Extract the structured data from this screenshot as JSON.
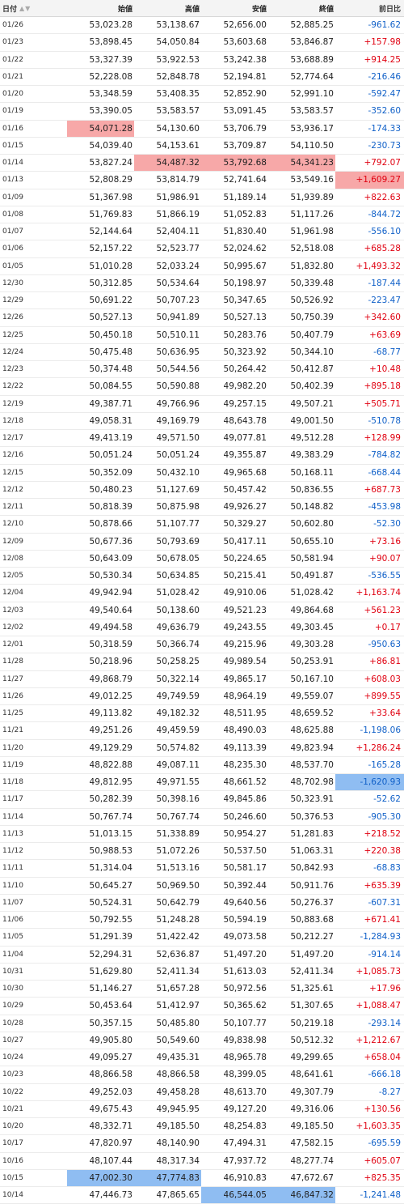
{
  "header": {
    "date": "日付",
    "sort_icon": "▲▼",
    "open": "始値",
    "high": "高値",
    "low": "安値",
    "close": "終値",
    "change": "前日比"
  },
  "colors": {
    "up": "#e00010",
    "down": "#1060c8",
    "highlight_high": "#f7a8a8",
    "highlight_low": "#8fbdf2"
  },
  "rows": [
    {
      "date": "01/26",
      "open": "53,023.28",
      "high": "53,138.67",
      "low": "52,656.00",
      "close": "52,885.25",
      "change": "-961.62",
      "dir": "neg",
      "hl": {}
    },
    {
      "date": "01/23",
      "open": "53,898.45",
      "high": "54,050.84",
      "low": "53,603.68",
      "close": "53,846.87",
      "change": "+157.98",
      "dir": "pos",
      "hl": {}
    },
    {
      "date": "01/22",
      "open": "53,327.39",
      "high": "53,922.53",
      "low": "53,242.38",
      "close": "53,688.89",
      "change": "+914.25",
      "dir": "pos",
      "hl": {}
    },
    {
      "date": "01/21",
      "open": "52,228.08",
      "high": "52,848.78",
      "low": "52,194.81",
      "close": "52,774.64",
      "change": "-216.46",
      "dir": "neg",
      "hl": {}
    },
    {
      "date": "01/20",
      "open": "53,348.59",
      "high": "53,408.35",
      "low": "52,852.90",
      "close": "52,991.10",
      "change": "-592.47",
      "dir": "neg",
      "hl": {}
    },
    {
      "date": "01/19",
      "open": "53,390.05",
      "high": "53,583.57",
      "low": "53,091.45",
      "close": "53,583.57",
      "change": "-352.60",
      "dir": "neg",
      "hl": {}
    },
    {
      "date": "01/16",
      "open": "54,071.28",
      "high": "54,130.60",
      "low": "53,706.79",
      "close": "53,936.17",
      "change": "-174.33",
      "dir": "neg",
      "hl": {
        "open": "red"
      }
    },
    {
      "date": "01/15",
      "open": "54,039.40",
      "high": "54,153.61",
      "low": "53,709.87",
      "close": "54,110.50",
      "change": "-230.73",
      "dir": "neg",
      "hl": {}
    },
    {
      "date": "01/14",
      "open": "53,827.24",
      "high": "54,487.32",
      "low": "53,792.68",
      "close": "54,341.23",
      "change": "+792.07",
      "dir": "pos",
      "hl": {
        "high": "red",
        "low": "red",
        "close": "red"
      }
    },
    {
      "date": "01/13",
      "open": "52,808.29",
      "high": "53,814.79",
      "low": "52,741.64",
      "close": "53,549.16",
      "change": "+1,609.27",
      "dir": "pos",
      "hl": {
        "change": "red"
      }
    },
    {
      "date": "01/09",
      "open": "51,367.98",
      "high": "51,986.91",
      "low": "51,189.14",
      "close": "51,939.89",
      "change": "+822.63",
      "dir": "pos",
      "hl": {}
    },
    {
      "date": "01/08",
      "open": "51,769.83",
      "high": "51,866.19",
      "low": "51,052.83",
      "close": "51,117.26",
      "change": "-844.72",
      "dir": "neg",
      "hl": {}
    },
    {
      "date": "01/07",
      "open": "52,144.64",
      "high": "52,404.11",
      "low": "51,830.40",
      "close": "51,961.98",
      "change": "-556.10",
      "dir": "neg",
      "hl": {}
    },
    {
      "date": "01/06",
      "open": "52,157.22",
      "high": "52,523.77",
      "low": "52,024.62",
      "close": "52,518.08",
      "change": "+685.28",
      "dir": "pos",
      "hl": {}
    },
    {
      "date": "01/05",
      "open": "51,010.28",
      "high": "52,033.24",
      "low": "50,995.67",
      "close": "51,832.80",
      "change": "+1,493.32",
      "dir": "pos",
      "hl": {}
    },
    {
      "date": "12/30",
      "open": "50,312.85",
      "high": "50,534.64",
      "low": "50,198.97",
      "close": "50,339.48",
      "change": "-187.44",
      "dir": "neg",
      "hl": {}
    },
    {
      "date": "12/29",
      "open": "50,691.22",
      "high": "50,707.23",
      "low": "50,347.65",
      "close": "50,526.92",
      "change": "-223.47",
      "dir": "neg",
      "hl": {}
    },
    {
      "date": "12/26",
      "open": "50,527.13",
      "high": "50,941.89",
      "low": "50,527.13",
      "close": "50,750.39",
      "change": "+342.60",
      "dir": "pos",
      "hl": {}
    },
    {
      "date": "12/25",
      "open": "50,450.18",
      "high": "50,510.11",
      "low": "50,283.76",
      "close": "50,407.79",
      "change": "+63.69",
      "dir": "pos",
      "hl": {}
    },
    {
      "date": "12/24",
      "open": "50,475.48",
      "high": "50,636.95",
      "low": "50,323.92",
      "close": "50,344.10",
      "change": "-68.77",
      "dir": "neg",
      "hl": {}
    },
    {
      "date": "12/23",
      "open": "50,374.48",
      "high": "50,544.56",
      "low": "50,264.42",
      "close": "50,412.87",
      "change": "+10.48",
      "dir": "pos",
      "hl": {}
    },
    {
      "date": "12/22",
      "open": "50,084.55",
      "high": "50,590.88",
      "low": "49,982.20",
      "close": "50,402.39",
      "change": "+895.18",
      "dir": "pos",
      "hl": {}
    },
    {
      "date": "12/19",
      "open": "49,387.71",
      "high": "49,766.96",
      "low": "49,257.15",
      "close": "49,507.21",
      "change": "+505.71",
      "dir": "pos",
      "hl": {}
    },
    {
      "date": "12/18",
      "open": "49,058.31",
      "high": "49,169.79",
      "low": "48,643.78",
      "close": "49,001.50",
      "change": "-510.78",
      "dir": "neg",
      "hl": {}
    },
    {
      "date": "12/17",
      "open": "49,413.19",
      "high": "49,571.50",
      "low": "49,077.81",
      "close": "49,512.28",
      "change": "+128.99",
      "dir": "pos",
      "hl": {}
    },
    {
      "date": "12/16",
      "open": "50,051.24",
      "high": "50,051.24",
      "low": "49,355.87",
      "close": "49,383.29",
      "change": "-784.82",
      "dir": "neg",
      "hl": {}
    },
    {
      "date": "12/15",
      "open": "50,352.09",
      "high": "50,432.10",
      "low": "49,965.68",
      "close": "50,168.11",
      "change": "-668.44",
      "dir": "neg",
      "hl": {}
    },
    {
      "date": "12/12",
      "open": "50,480.23",
      "high": "51,127.69",
      "low": "50,457.42",
      "close": "50,836.55",
      "change": "+687.73",
      "dir": "pos",
      "hl": {}
    },
    {
      "date": "12/11",
      "open": "50,818.39",
      "high": "50,875.98",
      "low": "49,926.27",
      "close": "50,148.82",
      "change": "-453.98",
      "dir": "neg",
      "hl": {}
    },
    {
      "date": "12/10",
      "open": "50,878.66",
      "high": "51,107.77",
      "low": "50,329.27",
      "close": "50,602.80",
      "change": "-52.30",
      "dir": "neg",
      "hl": {}
    },
    {
      "date": "12/09",
      "open": "50,677.36",
      "high": "50,793.69",
      "low": "50,417.11",
      "close": "50,655.10",
      "change": "+73.16",
      "dir": "pos",
      "hl": {}
    },
    {
      "date": "12/08",
      "open": "50,643.09",
      "high": "50,678.05",
      "low": "50,224.65",
      "close": "50,581.94",
      "change": "+90.07",
      "dir": "pos",
      "hl": {}
    },
    {
      "date": "12/05",
      "open": "50,530.34",
      "high": "50,634.85",
      "low": "50,215.41",
      "close": "50,491.87",
      "change": "-536.55",
      "dir": "neg",
      "hl": {}
    },
    {
      "date": "12/04",
      "open": "49,942.94",
      "high": "51,028.42",
      "low": "49,910.06",
      "close": "51,028.42",
      "change": "+1,163.74",
      "dir": "pos",
      "hl": {}
    },
    {
      "date": "12/03",
      "open": "49,540.64",
      "high": "50,138.60",
      "low": "49,521.23",
      "close": "49,864.68",
      "change": "+561.23",
      "dir": "pos",
      "hl": {}
    },
    {
      "date": "12/02",
      "open": "49,494.58",
      "high": "49,636.79",
      "low": "49,243.55",
      "close": "49,303.45",
      "change": "+0.17",
      "dir": "pos",
      "hl": {}
    },
    {
      "date": "12/01",
      "open": "50,318.59",
      "high": "50,366.74",
      "low": "49,215.96",
      "close": "49,303.28",
      "change": "-950.63",
      "dir": "neg",
      "hl": {}
    },
    {
      "date": "11/28",
      "open": "50,218.96",
      "high": "50,258.25",
      "low": "49,989.54",
      "close": "50,253.91",
      "change": "+86.81",
      "dir": "pos",
      "hl": {}
    },
    {
      "date": "11/27",
      "open": "49,868.79",
      "high": "50,322.14",
      "low": "49,865.17",
      "close": "50,167.10",
      "change": "+608.03",
      "dir": "pos",
      "hl": {}
    },
    {
      "date": "11/26",
      "open": "49,012.25",
      "high": "49,749.59",
      "low": "48,964.19",
      "close": "49,559.07",
      "change": "+899.55",
      "dir": "pos",
      "hl": {}
    },
    {
      "date": "11/25",
      "open": "49,113.82",
      "high": "49,182.32",
      "low": "48,511.95",
      "close": "48,659.52",
      "change": "+33.64",
      "dir": "pos",
      "hl": {}
    },
    {
      "date": "11/21",
      "open": "49,251.26",
      "high": "49,459.59",
      "low": "48,490.03",
      "close": "48,625.88",
      "change": "-1,198.06",
      "dir": "neg",
      "hl": {}
    },
    {
      "date": "11/20",
      "open": "49,129.29",
      "high": "50,574.82",
      "low": "49,113.39",
      "close": "49,823.94",
      "change": "+1,286.24",
      "dir": "pos",
      "hl": {}
    },
    {
      "date": "11/19",
      "open": "48,822.88",
      "high": "49,087.11",
      "low": "48,235.30",
      "close": "48,537.70",
      "change": "-165.28",
      "dir": "neg",
      "hl": {}
    },
    {
      "date": "11/18",
      "open": "49,812.95",
      "high": "49,971.55",
      "low": "48,661.52",
      "close": "48,702.98",
      "change": "-1,620.93",
      "dir": "neg",
      "hl": {
        "change": "blue"
      }
    },
    {
      "date": "11/17",
      "open": "50,282.39",
      "high": "50,398.16",
      "low": "49,845.86",
      "close": "50,323.91",
      "change": "-52.62",
      "dir": "neg",
      "hl": {}
    },
    {
      "date": "11/14",
      "open": "50,767.74",
      "high": "50,767.74",
      "low": "50,246.60",
      "close": "50,376.53",
      "change": "-905.30",
      "dir": "neg",
      "hl": {}
    },
    {
      "date": "11/13",
      "open": "51,013.15",
      "high": "51,338.89",
      "low": "50,954.27",
      "close": "51,281.83",
      "change": "+218.52",
      "dir": "pos",
      "hl": {}
    },
    {
      "date": "11/12",
      "open": "50,988.53",
      "high": "51,072.26",
      "low": "50,537.50",
      "close": "51,063.31",
      "change": "+220.38",
      "dir": "pos",
      "hl": {}
    },
    {
      "date": "11/11",
      "open": "51,314.04",
      "high": "51,513.16",
      "low": "50,581.17",
      "close": "50,842.93",
      "change": "-68.83",
      "dir": "neg",
      "hl": {}
    },
    {
      "date": "11/10",
      "open": "50,645.27",
      "high": "50,969.50",
      "low": "50,392.44",
      "close": "50,911.76",
      "change": "+635.39",
      "dir": "pos",
      "hl": {}
    },
    {
      "date": "11/07",
      "open": "50,524.31",
      "high": "50,642.79",
      "low": "49,640.56",
      "close": "50,276.37",
      "change": "-607.31",
      "dir": "neg",
      "hl": {}
    },
    {
      "date": "11/06",
      "open": "50,792.55",
      "high": "51,248.28",
      "low": "50,594.19",
      "close": "50,883.68",
      "change": "+671.41",
      "dir": "pos",
      "hl": {}
    },
    {
      "date": "11/05",
      "open": "51,291.39",
      "high": "51,422.42",
      "low": "49,073.58",
      "close": "50,212.27",
      "change": "-1,284.93",
      "dir": "neg",
      "hl": {}
    },
    {
      "date": "11/04",
      "open": "52,294.31",
      "high": "52,636.87",
      "low": "51,497.20",
      "close": "51,497.20",
      "change": "-914.14",
      "dir": "neg",
      "hl": {}
    },
    {
      "date": "10/31",
      "open": "51,629.80",
      "high": "52,411.34",
      "low": "51,613.03",
      "close": "52,411.34",
      "change": "+1,085.73",
      "dir": "pos",
      "hl": {}
    },
    {
      "date": "10/30",
      "open": "51,146.27",
      "high": "51,657.28",
      "low": "50,972.56",
      "close": "51,325.61",
      "change": "+17.96",
      "dir": "pos",
      "hl": {}
    },
    {
      "date": "10/29",
      "open": "50,453.64",
      "high": "51,412.97",
      "low": "50,365.62",
      "close": "51,307.65",
      "change": "+1,088.47",
      "dir": "pos",
      "hl": {}
    },
    {
      "date": "10/28",
      "open": "50,357.15",
      "high": "50,485.80",
      "low": "50,107.77",
      "close": "50,219.18",
      "change": "-293.14",
      "dir": "neg",
      "hl": {}
    },
    {
      "date": "10/27",
      "open": "49,905.80",
      "high": "50,549.60",
      "low": "49,838.98",
      "close": "50,512.32",
      "change": "+1,212.67",
      "dir": "pos",
      "hl": {}
    },
    {
      "date": "10/24",
      "open": "49,095.27",
      "high": "49,435.31",
      "low": "48,965.78",
      "close": "49,299.65",
      "change": "+658.04",
      "dir": "pos",
      "hl": {}
    },
    {
      "date": "10/23",
      "open": "48,866.58",
      "high": "48,866.58",
      "low": "48,399.05",
      "close": "48,641.61",
      "change": "-666.18",
      "dir": "neg",
      "hl": {}
    },
    {
      "date": "10/22",
      "open": "49,252.03",
      "high": "49,458.28",
      "low": "48,613.70",
      "close": "49,307.79",
      "change": "-8.27",
      "dir": "neg",
      "hl": {}
    },
    {
      "date": "10/21",
      "open": "49,675.43",
      "high": "49,945.95",
      "low": "49,127.20",
      "close": "49,316.06",
      "change": "+130.56",
      "dir": "pos",
      "hl": {}
    },
    {
      "date": "10/20",
      "open": "48,332.71",
      "high": "49,185.50",
      "low": "48,254.83",
      "close": "49,185.50",
      "change": "+1,603.35",
      "dir": "pos",
      "hl": {}
    },
    {
      "date": "10/17",
      "open": "47,820.97",
      "high": "48,140.90",
      "low": "47,494.31",
      "close": "47,582.15",
      "change": "-695.59",
      "dir": "neg",
      "hl": {}
    },
    {
      "date": "10/16",
      "open": "48,107.44",
      "high": "48,317.34",
      "low": "47,937.72",
      "close": "48,277.74",
      "change": "+605.07",
      "dir": "pos",
      "hl": {}
    },
    {
      "date": "10/15",
      "open": "47,002.30",
      "high": "47,774.83",
      "low": "46,910.83",
      "close": "47,672.67",
      "change": "+825.35",
      "dir": "pos",
      "hl": {
        "open": "blue",
        "high": "blue"
      }
    },
    {
      "date": "10/14",
      "open": "47,446.73",
      "high": "47,865.65",
      "low": "46,544.05",
      "close": "46,847.32",
      "change": "-1,241.48",
      "dir": "neg",
      "hl": {
        "low": "blue",
        "close": "blue"
      }
    }
  ]
}
